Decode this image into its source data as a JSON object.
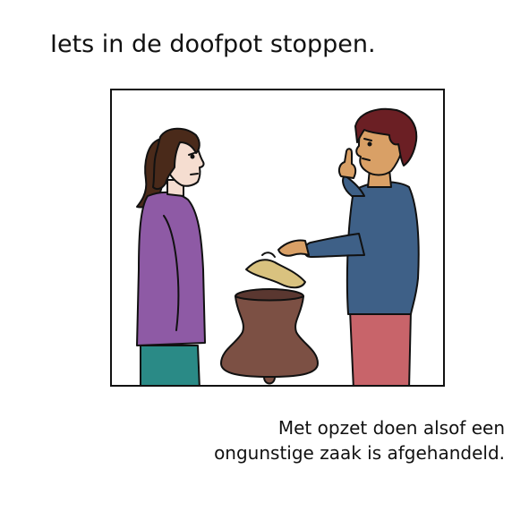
{
  "title": "Iets in de doofpot stoppen.",
  "illustration": {
    "subjects": [
      "woman",
      "man",
      "doofpot",
      "lid"
    ],
    "colors": {
      "woman_shirt": "#8e5aa5",
      "woman_pants": "#2a8a86",
      "woman_hair": "#4a2a1a",
      "woman_skin": "#f5ddd0",
      "man_shirt": "#3e6087",
      "man_pants": "#c8646a",
      "man_hair": "#6b1f24",
      "man_skin": "#d9a066",
      "pot": "#7c5044",
      "lid": "#d9c27f"
    }
  },
  "caption": {
    "line1": "Met opzet doen alsof een",
    "line2": "ongunstige zaak is afgehandeld."
  }
}
